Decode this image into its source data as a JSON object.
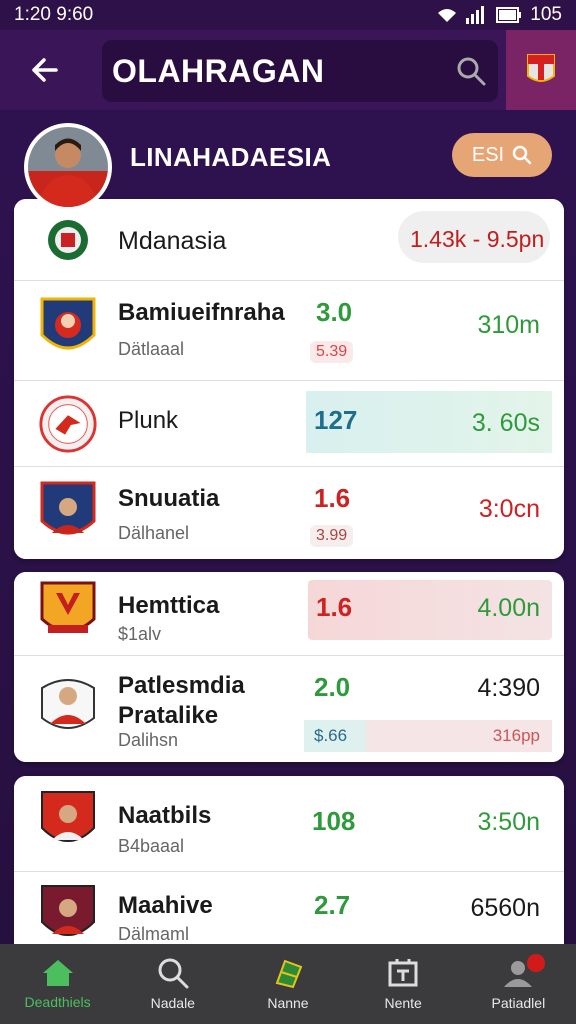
{
  "status": {
    "time": "1:20 9:60",
    "battery": "105"
  },
  "header": {
    "title": "OLAHRAGAN"
  },
  "section": {
    "title": "LINAHADAESIA",
    "filter_label": "ESI"
  },
  "rows": [
    {
      "name": "Mdanasia",
      "time_range": "1.43k - 9.5pn"
    },
    {
      "name": "Bamiueifnraha",
      "sub": "Dätlaaal",
      "odds": "3.0",
      "odds_small": "5.39",
      "time": "310m"
    },
    {
      "name": "Plunk",
      "odds": "127",
      "time": "3. 60s"
    },
    {
      "name": "Snuuatia",
      "sub": "Dälhanel",
      "odds": "1.6",
      "odds_small": "3.99",
      "time": "3:0cn"
    },
    {
      "name": "Hemttica",
      "sub": "$1alv",
      "odds": "1.6",
      "time": "4.00n"
    },
    {
      "name": "Patlesmdia",
      "name_line2": "Pratalike",
      "sub": "Dalihsn",
      "odds": "2.0",
      "odds_small": "$.66",
      "time": "4:390",
      "time_small": "316pp"
    },
    {
      "name": "Naatbils",
      "sub": "B4baaal",
      "odds": "108",
      "time": "3:50n"
    },
    {
      "name": "Maahive",
      "sub": "Dälmaml",
      "odds": "2.7",
      "time": "6560n"
    }
  ],
  "nav": [
    {
      "label": "Deadthiels",
      "icon": "home-icon"
    },
    {
      "label": "Nadale",
      "icon": "search-icon"
    },
    {
      "label": "Nanne",
      "icon": "soccer-field-icon"
    },
    {
      "label": "Nente",
      "icon": "scoreboard-icon"
    },
    {
      "label": "Patiadlel",
      "icon": "profile-icon"
    }
  ],
  "colors": {
    "green": "#2f9a3c",
    "red": "#cc2222",
    "teal": "#1e6f8c",
    "accent": "#4bbf5d"
  }
}
